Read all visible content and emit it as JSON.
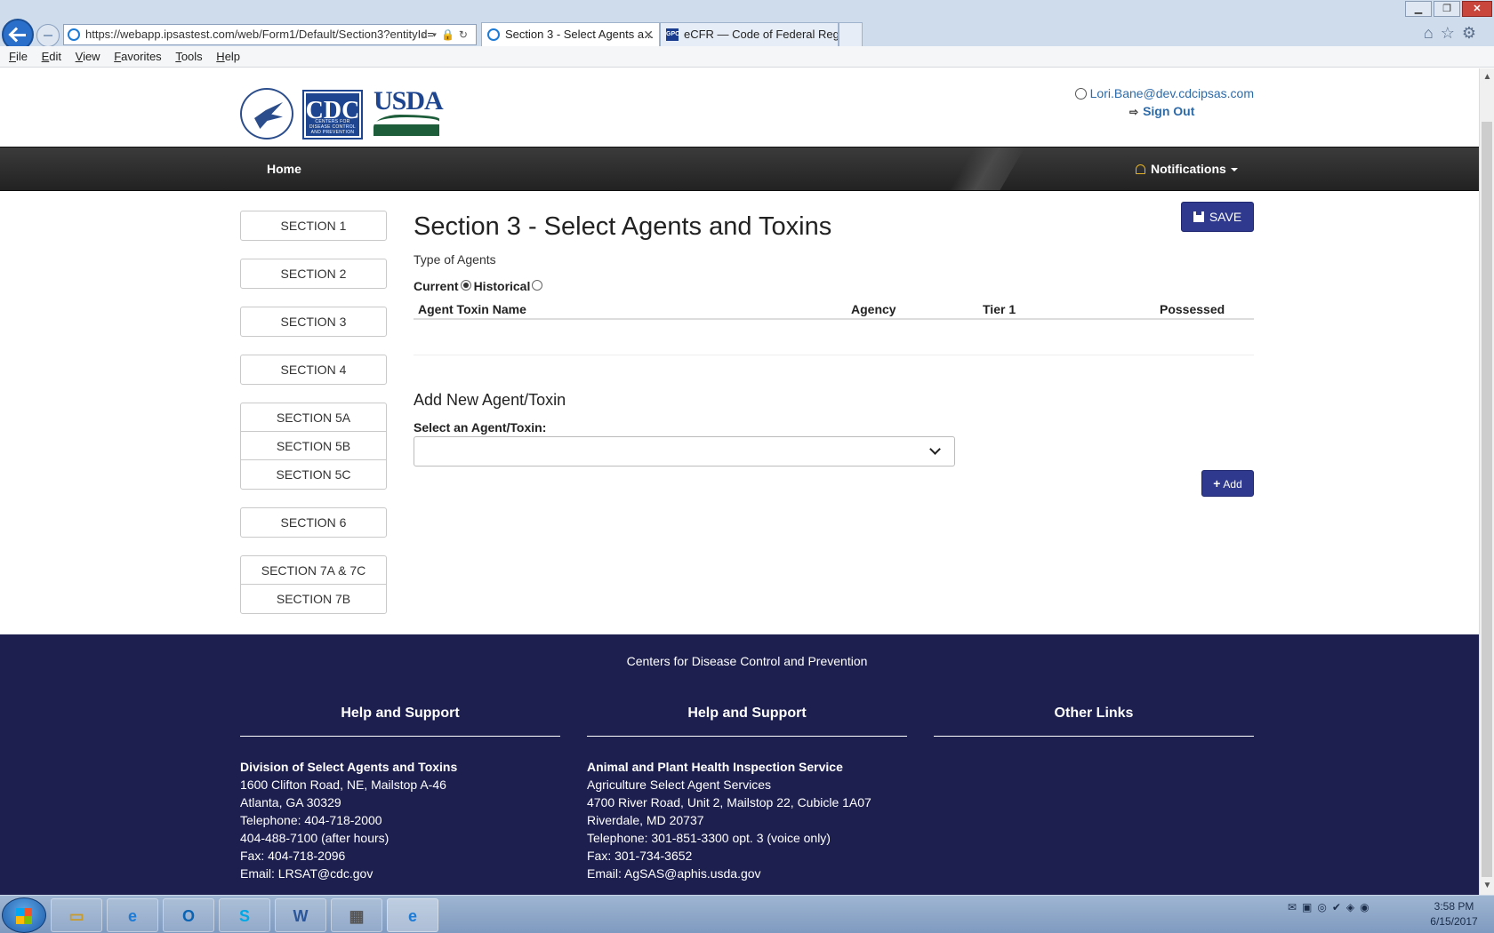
{
  "browser": {
    "url": "https://webapp.ipsastest.com/web/Form1/Default/Section3?entityId=",
    "tabs": [
      {
        "label": "Section 3 - Select Agents a..."
      },
      {
        "label": "eCFR — Code of Federal Regul..."
      }
    ],
    "menu": [
      "File",
      "Edit",
      "View",
      "Favorites",
      "Tools",
      "Help"
    ]
  },
  "header": {
    "cdc_logo_text": "CDC",
    "cdc_logo_sub": "CENTERS FOR DISEASE CONTROL AND PREVENTION",
    "usda_logo_text": "USDA",
    "user_email": "Lori.Bane@dev.cdcipsas.com",
    "sign_out": "Sign Out"
  },
  "navbar": {
    "home": "Home",
    "notifications": "Notifications"
  },
  "sidebar": {
    "groups": [
      [
        "SECTION 1"
      ],
      [
        "SECTION 2"
      ],
      [
        "SECTION 3"
      ],
      [
        "SECTION 4"
      ],
      [
        "SECTION 5A",
        "SECTION 5B",
        "SECTION 5C"
      ],
      [
        "SECTION 6"
      ],
      [
        "SECTION 7A & 7C",
        "SECTION 7B"
      ]
    ]
  },
  "main": {
    "title": "Section 3 - Select Agents and Toxins",
    "save_label": "SAVE",
    "type_label": "Type of Agents",
    "radio_current": "Current",
    "radio_historical": "Historical",
    "selected_type": "Current",
    "columns": [
      "Agent Toxin Name",
      "Agency",
      "Tier 1",
      "Possessed"
    ],
    "add_title": "Add New Agent/Toxin",
    "select_label": "Select an Agent/Toxin:",
    "select_value": "",
    "add_label": "Add"
  },
  "footer": {
    "org": "Centers for Disease Control and Prevention",
    "columns": [
      {
        "heading": "Help and Support",
        "lines": [
          "Division of Select Agents and Toxins",
          "1600 Clifton Road, NE, Mailstop A-46",
          "Atlanta, GA 30329",
          "Telephone: 404-718-2000",
          "404-488-7100 (after hours)",
          "Fax: 404-718-2096",
          "Email: LRSAT@cdc.gov"
        ]
      },
      {
        "heading": "Help and Support",
        "lines": [
          "Animal and Plant Health Inspection Service",
          "Agriculture Select Agent Services",
          "4700 River Road, Unit 2, Mailstop 22, Cubicle 1A07",
          "Riverdale, MD 20737",
          "Telephone: 301-851-3300 opt. 3 (voice only)",
          "Fax: 301-734-3652",
          "Email: AgSAS@aphis.usda.gov"
        ]
      },
      {
        "heading": "Other Links",
        "lines": []
      }
    ]
  },
  "taskbar": {
    "time": "3:58 PM",
    "date": "6/15/2017"
  },
  "colors": {
    "primary_button": "#2f3a8f",
    "footer_bg": "#1d1f4f",
    "navbar_bg": "#2a2a2a",
    "link": "#2d6aa8"
  }
}
